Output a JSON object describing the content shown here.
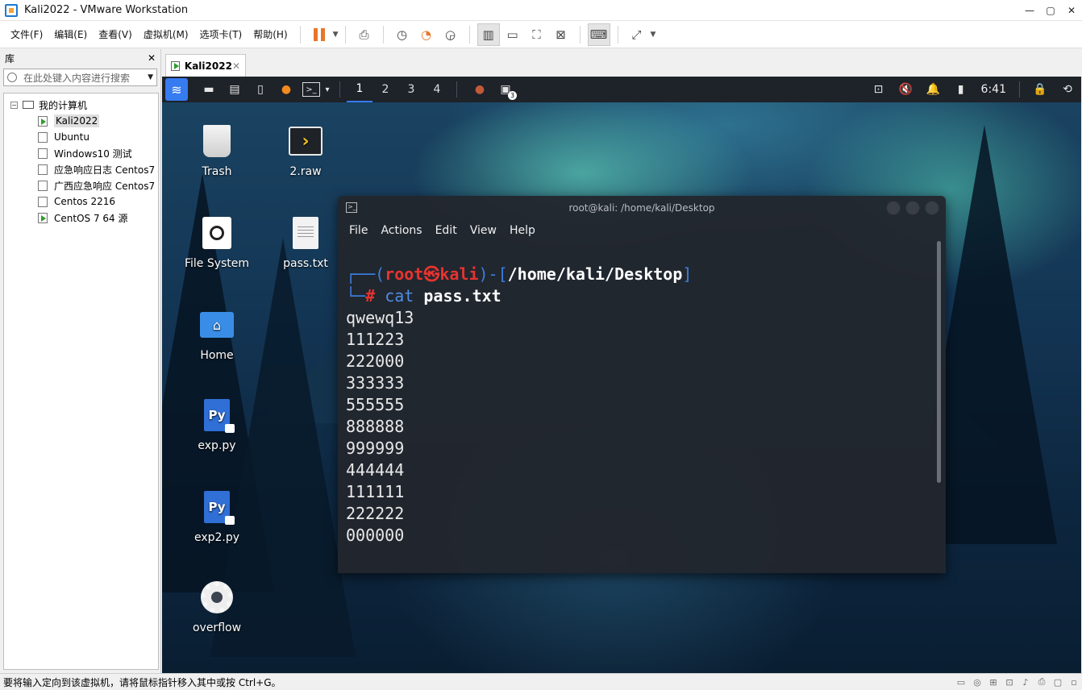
{
  "window": {
    "title": "Kali2022 - VMware Workstation",
    "controls": [
      "—",
      "▢",
      "✕"
    ]
  },
  "menu": {
    "items": [
      "文件(F)",
      "编辑(E)",
      "查看(V)",
      "虚拟机(M)",
      "选项卡(T)",
      "帮助(H)"
    ]
  },
  "toolbar": {
    "icons": [
      "pause-icon",
      "send-keys-icon",
      "snapshot-icon",
      "revert-snapshot-icon",
      "snapshot-manager-icon",
      "sidebar-icon",
      "thumbnail-icon",
      "fullscreen-icon",
      "unity-icon",
      "console-icon",
      "stretch-icon"
    ]
  },
  "library": {
    "header": "库",
    "close": "✕",
    "search_placeholder": "在此处键入内容进行搜索",
    "root": "我的计算机",
    "vms": [
      {
        "name": "Kali2022",
        "running": true,
        "selected": true
      },
      {
        "name": "Ubuntu",
        "running": false,
        "selected": false
      },
      {
        "name": "Windows10 测试",
        "running": false,
        "selected": false
      },
      {
        "name": "应急响应日志 Centos7",
        "running": false,
        "selected": false
      },
      {
        "name": "广西应急响应 Centos7",
        "running": false,
        "selected": false
      },
      {
        "name": "Centos 2216",
        "running": false,
        "selected": false
      },
      {
        "name": "CentOS 7 64 源",
        "running": true,
        "selected": false
      }
    ]
  },
  "tab": {
    "label": "Kali2022",
    "close": "✕"
  },
  "kali_panel": {
    "workspaces": [
      "1",
      "2",
      "3",
      "4"
    ],
    "active_workspace": "1",
    "clock": "6:41",
    "badge": "3"
  },
  "desktop": {
    "icons": [
      {
        "label": "Trash",
        "kind": "trash"
      },
      {
        "label": "2.raw",
        "kind": "raw"
      },
      {
        "label": "File System",
        "kind": "filesystem"
      },
      {
        "label": "pass.txt",
        "kind": "text"
      },
      {
        "label": "Home",
        "kind": "folder"
      },
      {
        "label": "exp.py",
        "kind": "python"
      },
      {
        "label": "exp2.py",
        "kind": "python"
      },
      {
        "label": "overflow",
        "kind": "gear"
      }
    ]
  },
  "terminal": {
    "title": "root@kali: /home/kali/Desktop",
    "menu": [
      "File",
      "Actions",
      "Edit",
      "View",
      "Help"
    ],
    "prompt": {
      "open_bracket": "┌──(",
      "user": "root",
      "symbol": "㉿",
      "host": "kali",
      "mid": ")-[",
      "path": "/home/kali/Desktop",
      "close": "]",
      "second_prefix": "└─",
      "hash": "#",
      "cmd": "cat",
      "arg": "pass.txt"
    },
    "output": [
      "qwewq13",
      "111223",
      "222000",
      "333333",
      "555555",
      "888888",
      "999999",
      "444444",
      "111111",
      "222222",
      "000000"
    ]
  },
  "statusbar": {
    "message": "要将输入定向到该虚拟机，请将鼠标指针移入其中或按 Ctrl+G。"
  }
}
